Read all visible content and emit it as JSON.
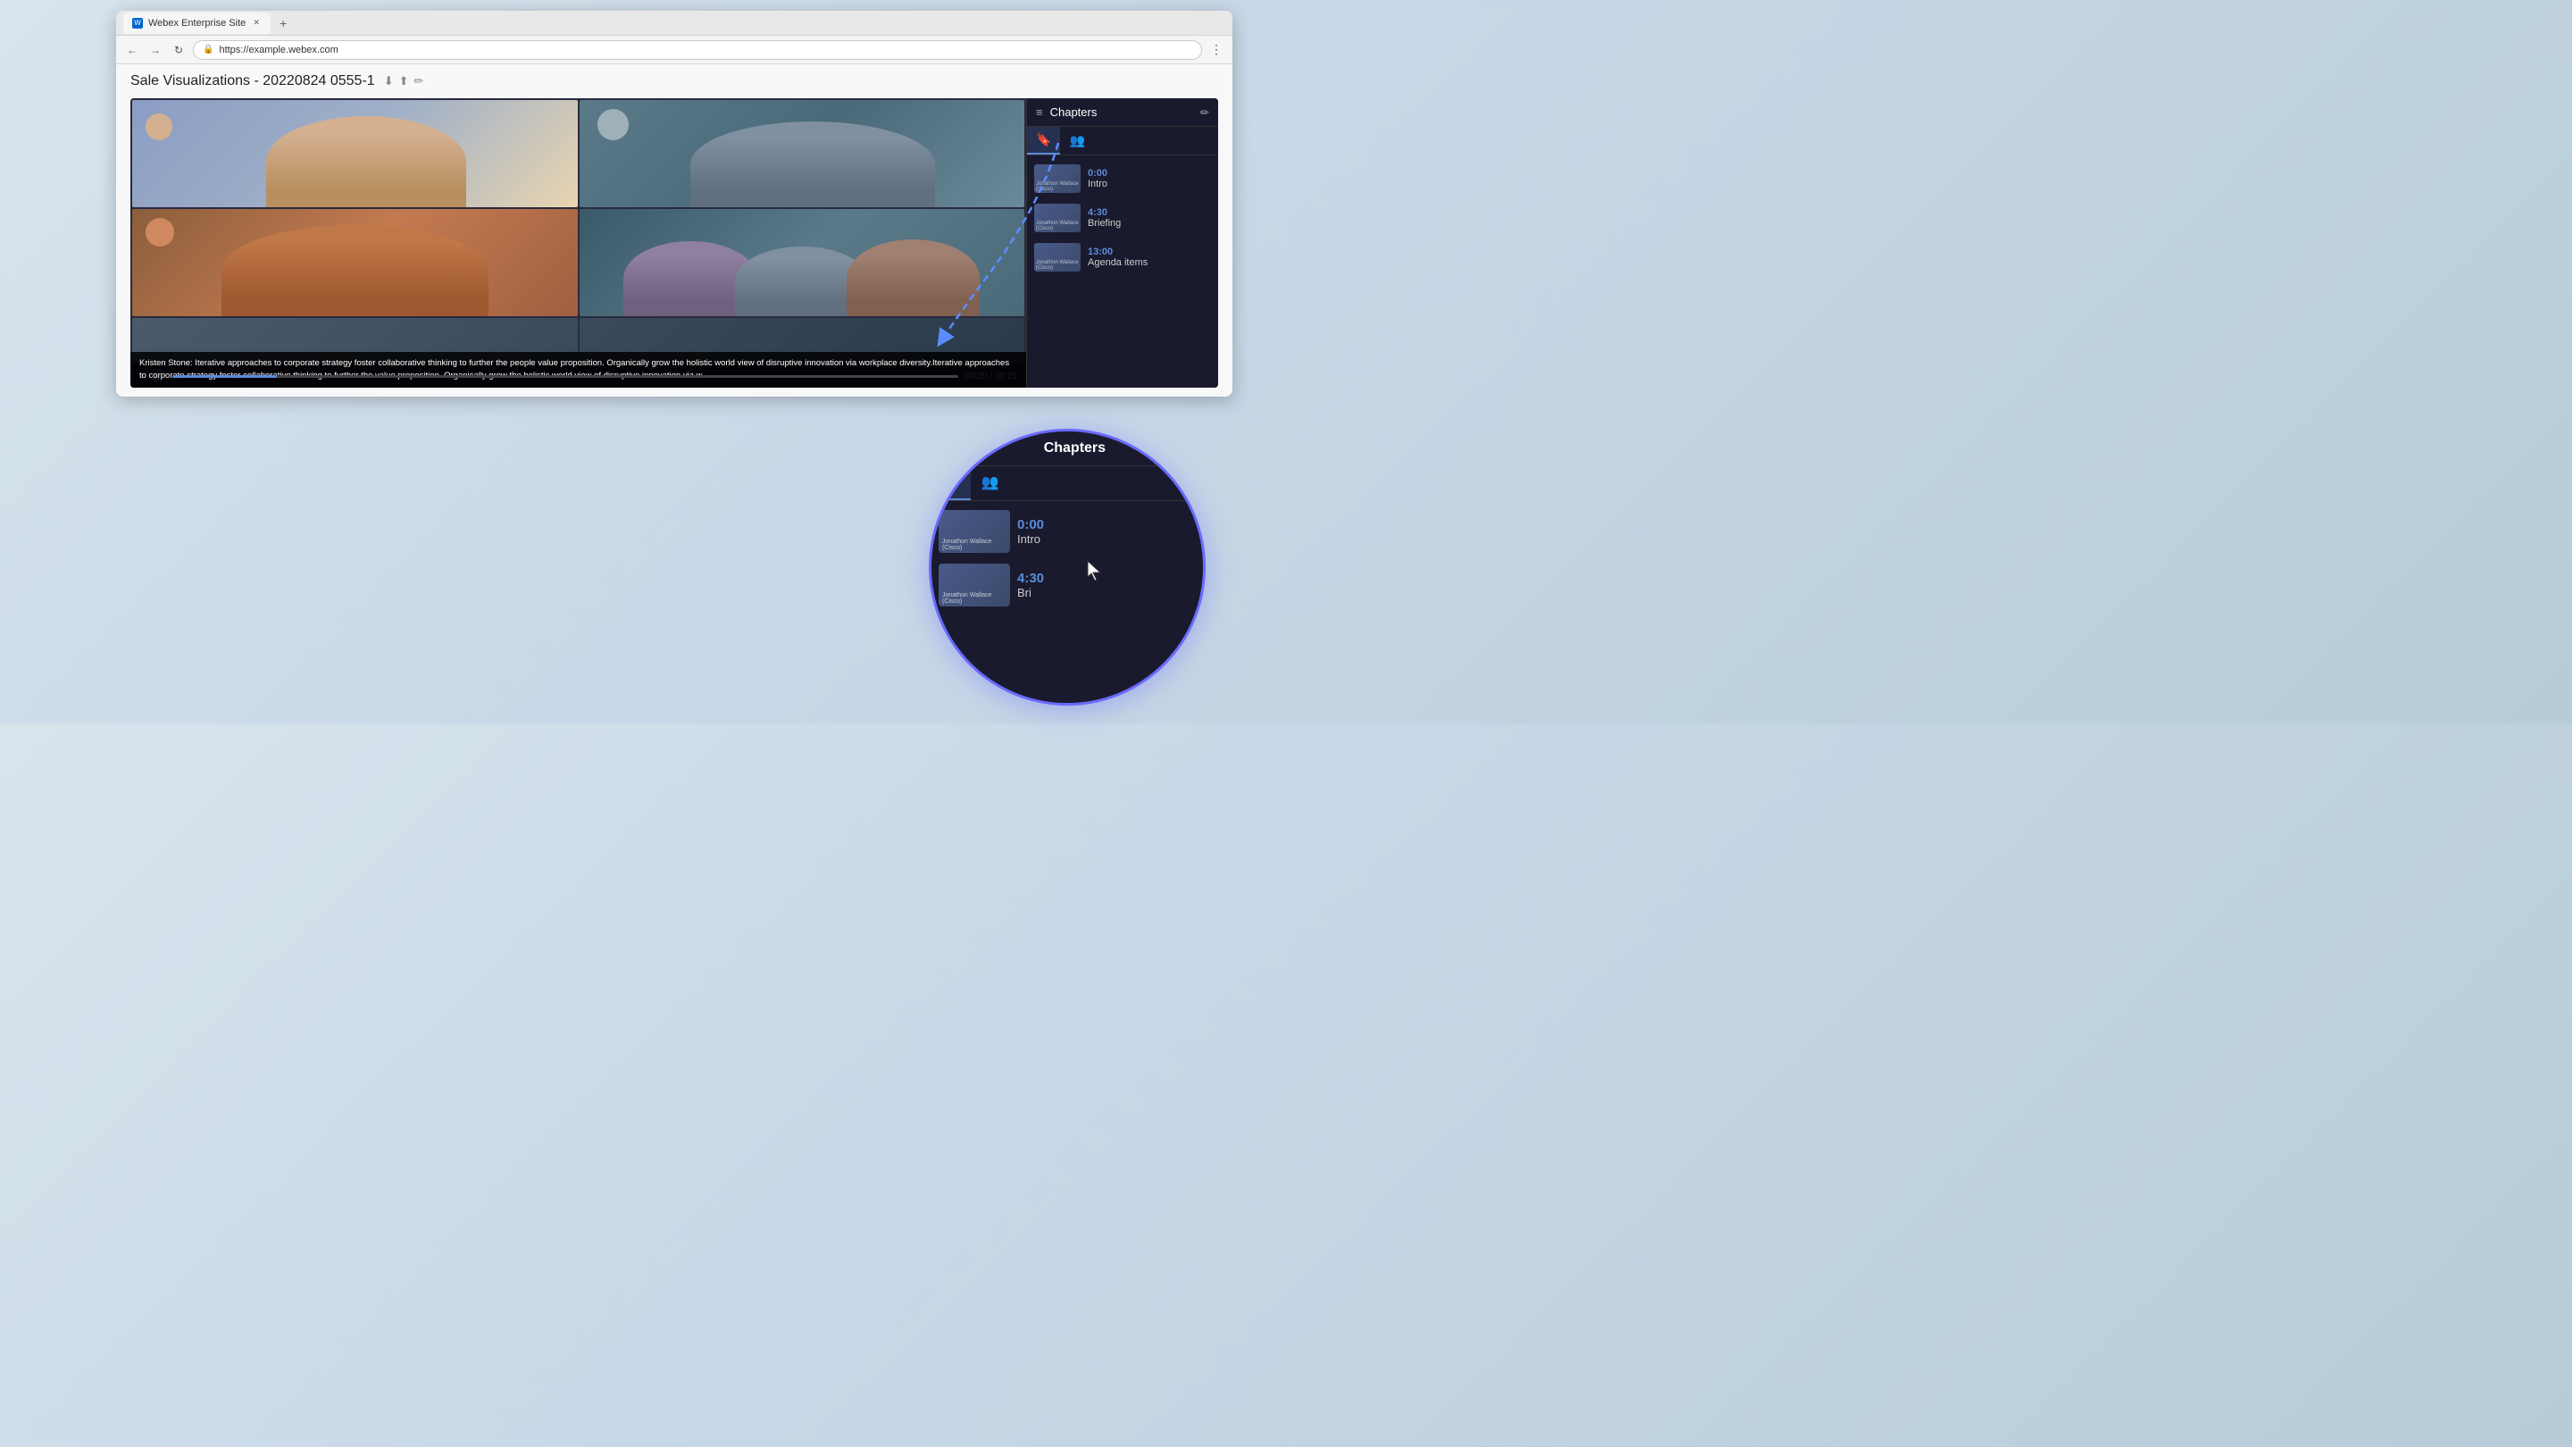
{
  "browser": {
    "tab_label": "Webex Enterprise Site",
    "url": "https://example.webex.com",
    "favicon_symbol": "W"
  },
  "page": {
    "title": "Sale Visualizations - 20220824 0555-1",
    "download_icon": "⬇",
    "share_icon": "⬆",
    "edit_icon": "✏"
  },
  "video": {
    "current_time": "00:20",
    "total_time": "00:25",
    "progress_percent": 13.3,
    "subtitle_text": "Kristen Stone: Iterative approaches to corporate strategy foster collaborative thinking to further the people value proposition. Organically grow the holistic world view of disruptive innovation via workplace diversity.Iterative approaches to corporate strategy foster collaborative thinking to further the value proposition. Organically grow the holistic world view of disruptive innovation via w..."
  },
  "chapters_sidebar": {
    "title": "Chapters",
    "edit_icon": "✏",
    "tab_bookmark_label": "Chapters tab",
    "tab_people_label": "People tab",
    "items": [
      {
        "time": "0:00",
        "name": "Intro",
        "thumb_label": "Jonathon Wallace (Cisco)"
      },
      {
        "time": "4:30",
        "name": "Briefing",
        "thumb_label": "Jonathon Wallace (Cisco)"
      },
      {
        "time": "13:00",
        "name": "Agenda items",
        "thumb_label": "Jonathon Wallace (Cisco)"
      }
    ]
  },
  "magnify": {
    "title": "Chapters",
    "chapter_0_time": "0:00",
    "chapter_0_name": "Intro",
    "chapter_0_thumb_label": "Jonathon Wallace (Cisco)",
    "chapter_1_time": "4:30",
    "chapter_1_name": "Bri",
    "chapter_1_thumb_label": "Jonathon Wallace (Cisco)"
  },
  "cursor": {
    "visible": true
  }
}
